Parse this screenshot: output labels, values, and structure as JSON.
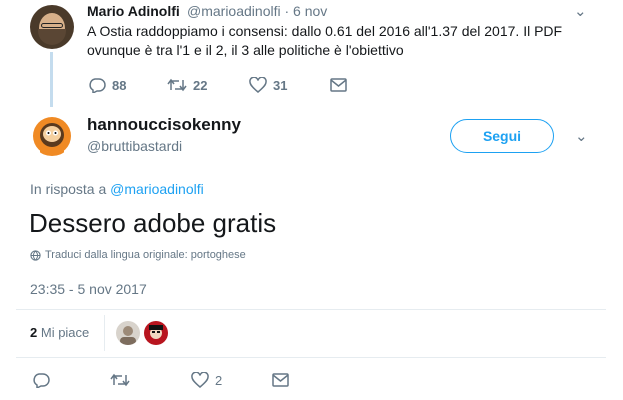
{
  "parent_tweet": {
    "author_name": "Mario Adinolfi",
    "author_handle": "@marioadinolfi",
    "date": "6 nov",
    "separator": "·",
    "text_line1": "A Ostia raddoppiamo i consensi: dallo 0.61 del 2016 all'1.37 del 2017. Il PDF",
    "text_line2": "ovunque è tra l'1 e il 2, il 3 alle politiche è l'obiettivo",
    "replies": "88",
    "retweets": "22",
    "likes": "31",
    "menu_glyph": "⌄"
  },
  "main_tweet": {
    "author_name": "hannouccisokenny",
    "author_handle": "@bruttibastardi",
    "follow_label": "Segui",
    "menu_glyph": "⌄",
    "reply_prefix": "In risposta a",
    "reply_handle": "@marioadinolfi",
    "text": "Dessero adobe gratis",
    "translate_text": "Traduci dalla lingua originale: portoghese",
    "timestamp": "23:35 - 5 nov 2017",
    "likes_count": "2",
    "likes_label": "Mi piace",
    "actions_likes": "2"
  },
  "icons": {
    "reply": "reply-icon",
    "retweet": "retweet-icon",
    "like": "heart-icon",
    "dm": "envelope-icon",
    "globe": "globe-icon"
  },
  "colors": {
    "accent": "#1da1f2",
    "muted": "#657786",
    "text": "#14171a",
    "thread_line": "#c4dcee"
  }
}
